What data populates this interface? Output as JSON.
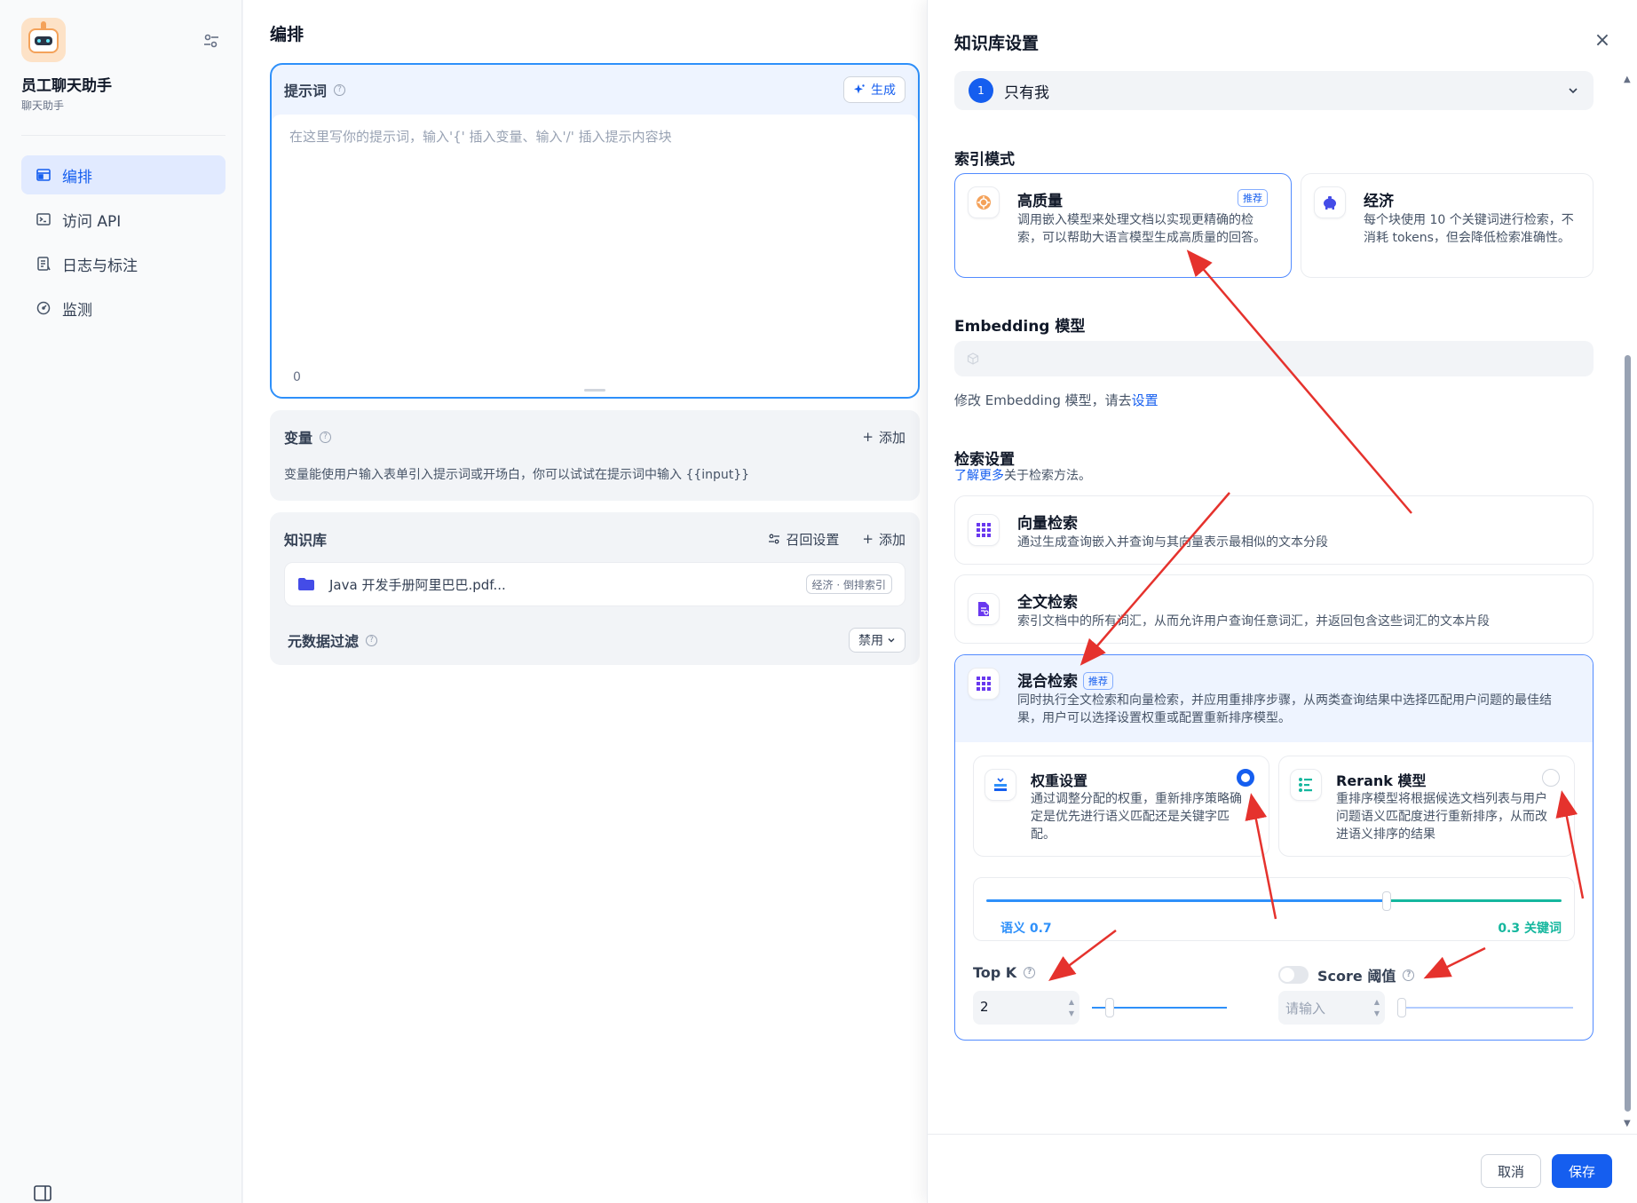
{
  "sidebar": {
    "app_name": "员工聊天助手",
    "app_subtitle": "聊天助手",
    "items": [
      {
        "label": "编排",
        "icon": "layout-icon",
        "active": true
      },
      {
        "label": "访问 API",
        "icon": "terminal-icon",
        "active": false
      },
      {
        "label": "日志与标注",
        "icon": "log-icon",
        "active": false
      },
      {
        "label": "监测",
        "icon": "gauge-icon",
        "active": false
      }
    ]
  },
  "main": {
    "title": "编排",
    "prompt": {
      "title": "提示词",
      "generate_label": "生成",
      "placeholder": "在这里写你的提示词，输入'{' 插入变量、输入'/' 插入提示内容块",
      "char_count": "0"
    },
    "variables": {
      "title": "变量",
      "add_label": "添加",
      "description": "变量能使用户输入表单引入提示词或开场白，你可以试试在提示词中输入 {{input}}"
    },
    "knowledge": {
      "title": "知识库",
      "recall_label": "召回设置",
      "add_label": "添加",
      "item_name": "Java 开发手册阿里巴巴.pdf...",
      "item_badge": "经济 · 倒排索引"
    },
    "metadata_filter": {
      "title": "元数据过滤",
      "value": "禁用"
    }
  },
  "drawer": {
    "title": "知识库设置",
    "permission": {
      "number": "1",
      "value": "只有我"
    },
    "index_mode": {
      "label": "索引模式",
      "high_quality": {
        "title": "高质量",
        "tag": "推荐",
        "desc": "调用嵌入模型来处理文档以实现更精确的检索，可以帮助大语言模型生成高质量的回答。"
      },
      "economy": {
        "title": "经济",
        "desc": "每个块使用 10 个关键词进行检索，不消耗 tokens，但会降低检索准确性。"
      }
    },
    "embedding": {
      "label": "Embedding 模型",
      "hint_prefix": "修改 Embedding 模型，请去",
      "hint_link": "设置"
    },
    "retrieval": {
      "label": "检索设置",
      "learn_more": "了解更多",
      "learn_suffix": "关于检索方法。",
      "vector": {
        "title": "向量检索",
        "desc": "通过生成查询嵌入并查询与其向量表示最相似的文本分段"
      },
      "fulltext": {
        "title": "全文检索",
        "desc": "索引文档中的所有词汇，从而允许用户查询任意词汇，并返回包含这些词汇的文本片段"
      },
      "hybrid": {
        "title": "混合检索",
        "tag": "推荐",
        "desc": "同时执行全文检索和向量检索，并应用重排序步骤，从两类查询结果中选择匹配用户问题的最佳结果，用户可以选择设置权重或配置重新排序模型。"
      },
      "weight_setting": {
        "title": "权重设置",
        "desc": "通过调整分配的权重，重新排序策略确定是优先进行语义匹配还是关键字匹配。",
        "selected": true
      },
      "rerank_model": {
        "title": "Rerank 模型",
        "desc": "重排序模型将根据候选文档列表与用户问题语义匹配度进行重新排序，从而改进语义排序的结果",
        "selected": false
      },
      "weights": {
        "semantic_label": "语义 0.7",
        "keyword_label": "0.3 关键词",
        "semantic": 0.7,
        "keyword": 0.3
      },
      "top_k": {
        "label": "Top K",
        "value": "2",
        "level": 0.1
      },
      "score_threshold": {
        "label": "Score 阈值",
        "placeholder": "请输入",
        "enabled": false,
        "level": 0.0
      }
    },
    "footer": {
      "cancel": "取消",
      "save": "保存"
    }
  },
  "colors": {
    "primary": "#155eef",
    "semantic": "#2e90fa",
    "keyword": "#15b79e",
    "annotation": "#e5322d"
  }
}
